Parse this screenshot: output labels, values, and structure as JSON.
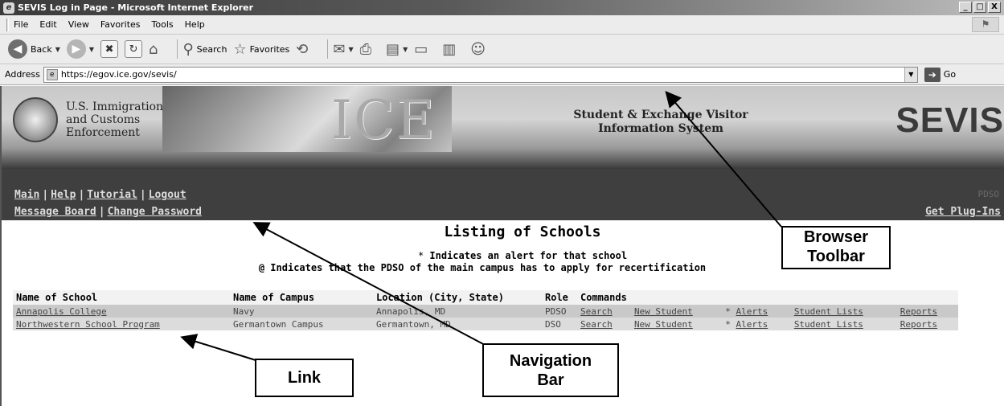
{
  "window": {
    "title": "SEVIS Log in Page - Microsoft Internet Explorer",
    "min_label": "_",
    "max_label": "□",
    "close_label": "X"
  },
  "menu": [
    "File",
    "Edit",
    "View",
    "Favorites",
    "Tools",
    "Help"
  ],
  "toolbar": {
    "back_label": "Back",
    "search_label": "Search",
    "favorites_label": "Favorites"
  },
  "address": {
    "label": "Address",
    "url": "https://egov.ice.gov/sevis/",
    "go_label": "Go"
  },
  "banner": {
    "agency_line1": "U.S. Immigration",
    "agency_line2": "and Customs",
    "agency_line3": "Enforcement",
    "ice_wordmark": "ICE",
    "system_line1": "Student & Exchange Visitor",
    "system_line2": "Information System",
    "sevis_wordmark": "SEVIS"
  },
  "nav": {
    "row1": [
      "Main",
      "Help",
      "Tutorial",
      "Logout"
    ],
    "row2": [
      "Message Board",
      "Change Password"
    ],
    "role": "PDSO",
    "plugins": "Get Plug-Ins"
  },
  "content": {
    "title": "Listing of Schools",
    "note_alert": "Indicates an alert for that school",
    "note_recert": "Indicates that the PDSO of the main campus has to apply for recertification",
    "columns": [
      "Name of School",
      "Name of Campus",
      "Location (City, State)",
      "Role",
      "Commands"
    ],
    "rows": [
      {
        "school": "Annapolis College",
        "campus": "Navy",
        "location": "Annapolis, MD",
        "role": "PDSO",
        "search": "Search",
        "new_student": "New Student",
        "alerts": "Alerts",
        "student_lists": "Student Lists",
        "reports": "Reports"
      },
      {
        "school": "Northwestern School Program",
        "campus": "Germantown Campus",
        "location": "Germantown, MD",
        "role": "DSO",
        "search": "Search",
        "new_student": "New Student",
        "alerts": "Alerts",
        "student_lists": "Student Lists",
        "reports": "Reports"
      }
    ]
  },
  "annotations": {
    "browser_toolbar": [
      "Browser",
      "Toolbar"
    ],
    "navigation_bar": [
      "Navigation",
      "Bar"
    ],
    "link": "Link"
  }
}
